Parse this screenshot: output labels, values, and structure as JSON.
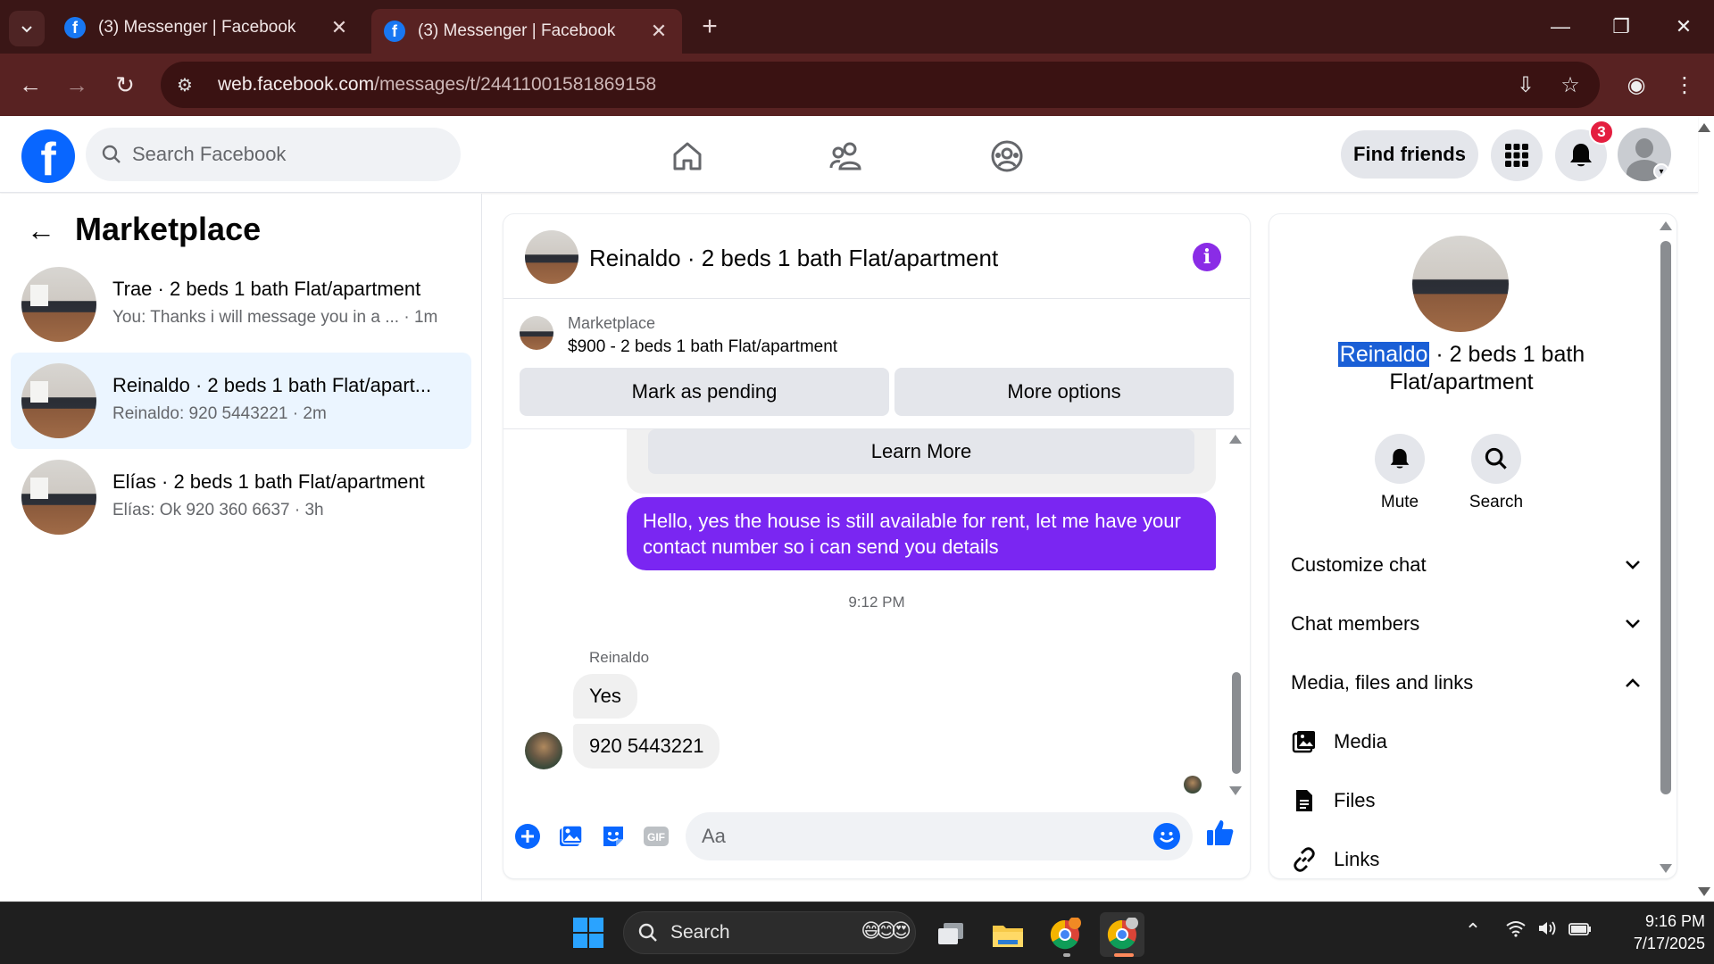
{
  "browser": {
    "tabs": [
      {
        "title": "(3) Messenger | Facebook"
      },
      {
        "title": "(3) Messenger | Facebook"
      }
    ],
    "url_host": "web.facebook.com",
    "url_path": "/messages/t/24411001581869158"
  },
  "header": {
    "search_placeholder": "Search Facebook",
    "find_friends_label": "Find friends",
    "notification_count": "3"
  },
  "sidebar": {
    "title": "Marketplace",
    "conversations": [
      {
        "name": "Trae · 2 beds 1 bath Flat/apartment",
        "preview": "You: Thanks i will message you in a ...",
        "time": " · 1m",
        "active": false
      },
      {
        "name": "Reinaldo · 2 beds 1 bath Flat/apart...",
        "preview": "Reinaldo: 920 5443221 · 2m",
        "time": "",
        "active": true
      },
      {
        "name": "Elías · 2 beds 1 bath Flat/apartment",
        "preview": "Elías: Ok 920 360 6637 · 3h",
        "time": "",
        "active": false
      }
    ]
  },
  "chat": {
    "title": "Reinaldo · 2 beds 1 bath Flat/apartment",
    "marketplace_label": "Marketplace",
    "listing": "$900 - 2 beds 1 bath Flat/apartment",
    "mark_pending_label": "Mark as pending",
    "more_options_label": "More options",
    "learn_more_label": "Learn More",
    "outgoing_message": "Hello, yes the house is still available for rent, let me have your contact number so i can send you details",
    "timestamp": "9:12 PM",
    "sender_name": "Reinaldo",
    "incoming_messages": [
      "Yes",
      "920 5443221"
    ],
    "composer_placeholder": "Aa"
  },
  "details": {
    "name_highlight": "Reinaldo",
    "name_rest": " · 2 beds 1 bath Flat/apartment",
    "mute_label": "Mute",
    "search_label": "Search",
    "customize_label": "Customize chat",
    "members_label": "Chat members",
    "media_section_label": "Media, files and links",
    "media_label": "Media",
    "files_label": "Files",
    "links_label": "Links"
  },
  "taskbar": {
    "search_label": "Search",
    "time": "9:16 PM",
    "date": "7/17/2025"
  },
  "colors": {
    "facebook_blue": "#0866ff",
    "outgoing_bubble": "#7a26f2",
    "browser_frame": "#3a1616"
  }
}
